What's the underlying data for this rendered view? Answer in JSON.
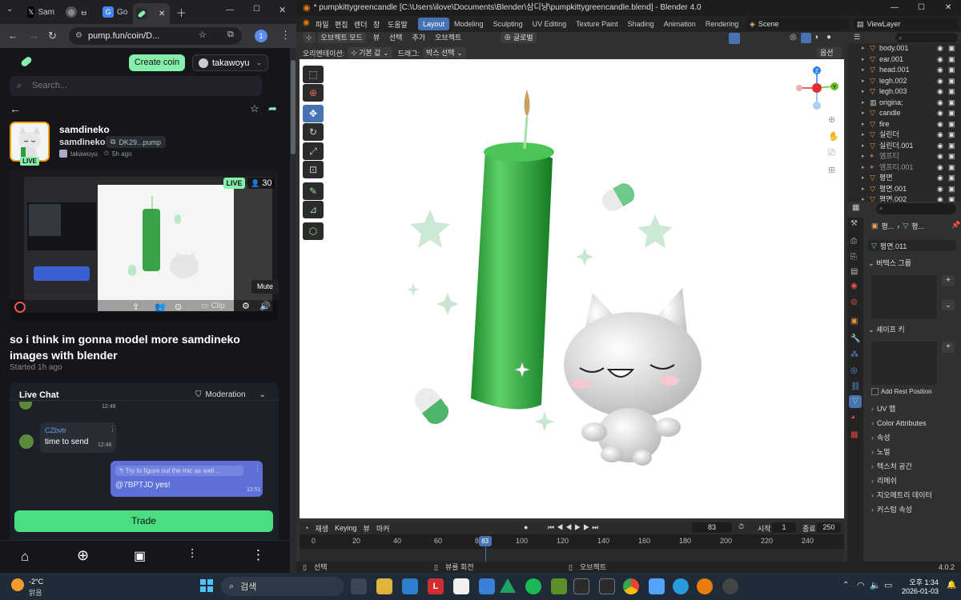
{
  "browser": {
    "tabs": [
      {
        "label": "Sam",
        "icon": "x-icon"
      },
      {
        "label": "ㅂ",
        "icon": "chrome-icon"
      },
      {
        "label": "Go",
        "icon": "google-icon"
      },
      {
        "label": "",
        "icon": "pump-icon"
      }
    ],
    "url": "pump.fun/coin/D..."
  },
  "pump": {
    "create_coin": "Create coin",
    "username": "takawoyu",
    "search_placeholder": "Search...",
    "coin_name": "samdineko",
    "coin_ticker": "samdineko",
    "contract": "DK29...pump",
    "creator": "takawoyu",
    "created_ago": "5h ago",
    "live_badge": "LIVE",
    "video_live": "LIVE",
    "viewers": "30",
    "mute_tooltip": "Mute",
    "clip_label": "Clip",
    "stream_title": "so i think im gonna model more samdineko images with blender",
    "started": "Started 1h ago",
    "live_chat": "Live Chat",
    "moderation": "Moderation",
    "chat": [
      {
        "time": "12:48",
        "user": "",
        "text": ""
      },
      {
        "time": "12:48",
        "user": "CZbvtr",
        "text": "time to send"
      },
      {
        "time": "12:51",
        "reply_to": "Try to figure out the mic as well ...",
        "mention": "@7BPTJD",
        "text": "yes!"
      }
    ],
    "trade": "Trade"
  },
  "blender": {
    "title": "* pumpkittygreencandle [C:\\Users\\ilove\\Documents\\Blender\\삼디냥\\pumpkittygreencandle.blend] - Blender 4.0",
    "menu": [
      "파일",
      "편집",
      "렌더",
      "창",
      "도움말"
    ],
    "workspaces": [
      "Layout",
      "Modeling",
      "Sculpting",
      "UV Editing",
      "Texture Paint",
      "Shading",
      "Animation",
      "Rendering"
    ],
    "scene": "Scene",
    "view_layer": "ViewLayer",
    "vp_header": [
      "오브젝트 모드",
      "뷰",
      "선택",
      "추가",
      "오브젝트"
    ],
    "transform": "글로벌",
    "orientation_label": "오리엔테이션:",
    "orientation_value": "기본 값",
    "drag_label": "드래그:",
    "drag_value": "박스 선택",
    "options": "옵션",
    "outliner": [
      {
        "name": "body.001",
        "kind": "mesh"
      },
      {
        "name": "ear.001",
        "kind": "mesh"
      },
      {
        "name": "head.001",
        "kind": "mesh"
      },
      {
        "name": "legh.002",
        "kind": "mesh"
      },
      {
        "name": "legh.003",
        "kind": "mesh"
      },
      {
        "name": "origina;",
        "kind": "collection"
      },
      {
        "name": "candle",
        "kind": "mesh"
      },
      {
        "name": "fire",
        "kind": "mesh"
      },
      {
        "name": "실린더",
        "kind": "mesh"
      },
      {
        "name": "실린더.001",
        "kind": "mesh"
      },
      {
        "name": "엠프티",
        "kind": "empty"
      },
      {
        "name": "엠프티.001",
        "kind": "empty"
      },
      {
        "name": "평면",
        "kind": "mesh"
      },
      {
        "name": "평면.001",
        "kind": "mesh"
      },
      {
        "name": "평면.002",
        "kind": "mesh"
      }
    ],
    "props_breadcrumb": [
      "평...",
      "평..."
    ],
    "mesh_name": "평면.011",
    "vertex_groups": "버텍스 그룹",
    "shape_keys": "셰이프 키",
    "add_rest_position": "Add Rest Position",
    "sections": [
      "UV 맵",
      "Color Attributes",
      "속성",
      "노멀",
      "텍스처 공간",
      "리메쉬",
      "지오메트리 데이터",
      "커스텀 속성"
    ],
    "timeline": {
      "playback": "재생",
      "keying": "Keying",
      "view": "뷰",
      "marker": "마커",
      "current_frame": "83",
      "start_label": "시작",
      "start": "1",
      "end_label": "종료",
      "end": "250",
      "ticks": [
        "0",
        "20",
        "40",
        "60",
        "80",
        "100",
        "120",
        "140",
        "160",
        "180",
        "200",
        "220",
        "240"
      ]
    },
    "status": {
      "select": "선택",
      "rotate": "뷰를 회전",
      "object": "오브젝트",
      "version": "4.0.2"
    }
  },
  "taskbar": {
    "weather_temp": "-2°C",
    "weather_desc": "맑음",
    "search": "검색",
    "time": "오후 1:34",
    "date": "2026-01-03"
  }
}
